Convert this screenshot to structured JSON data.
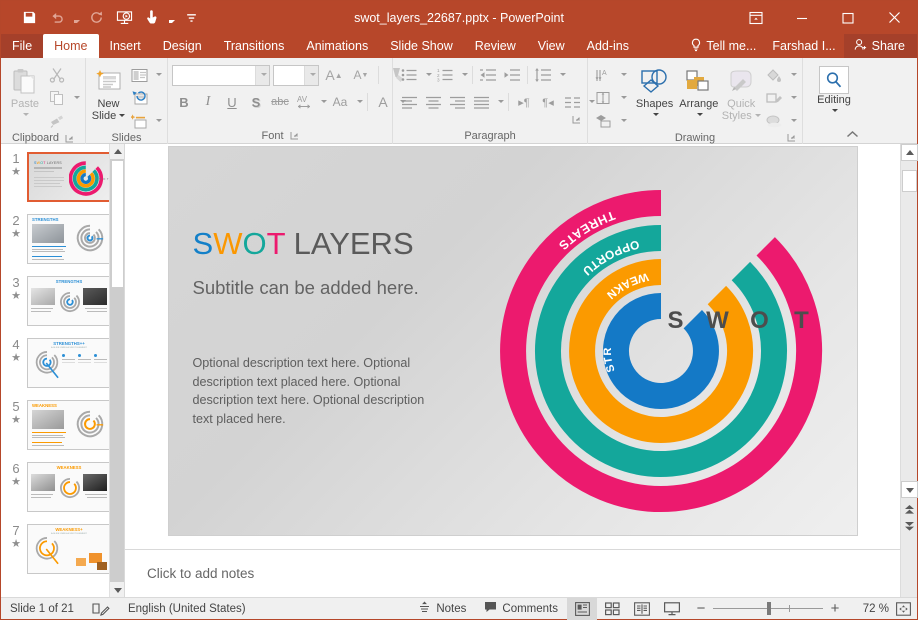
{
  "titlebar": {
    "document_title": "swot_layers_22687.pptx - PowerPoint",
    "quick_access": [
      {
        "name": "save-icon",
        "label": "Save"
      },
      {
        "name": "undo-icon",
        "label": "Undo"
      },
      {
        "name": "redo-icon",
        "label": "Redo"
      },
      {
        "name": "start-presentation-icon",
        "label": "Start From Beginning"
      },
      {
        "name": "touch-mode-icon",
        "label": "Touch/Mouse Mode"
      },
      {
        "name": "customize-qat-icon",
        "label": "Customize Quick Access Toolbar"
      }
    ],
    "window_controls": [
      {
        "name": "ribbon-display-options-icon",
        "label": "Ribbon Display Options"
      },
      {
        "name": "minimize-icon",
        "label": "Minimize"
      },
      {
        "name": "maximize-icon",
        "label": "Restore Down"
      },
      {
        "name": "close-icon",
        "label": "Close"
      }
    ]
  },
  "tabs": [
    {
      "label": "File",
      "active": false,
      "file": true
    },
    {
      "label": "Home",
      "active": true
    },
    {
      "label": "Insert",
      "active": false
    },
    {
      "label": "Design",
      "active": false
    },
    {
      "label": "Transitions",
      "active": false
    },
    {
      "label": "Animations",
      "active": false
    },
    {
      "label": "Slide Show",
      "active": false
    },
    {
      "label": "Review",
      "active": false
    },
    {
      "label": "View",
      "active": false
    },
    {
      "label": "Add-ins",
      "active": false
    }
  ],
  "tabstrip_right": {
    "tell_me": "Tell me...",
    "account": "Farshad I...",
    "share": "Share"
  },
  "ribbon": {
    "groups": [
      {
        "label": "Clipboard",
        "has_launcher": true
      },
      {
        "label": "Slides",
        "has_launcher": false
      },
      {
        "label": "Font",
        "has_launcher": true
      },
      {
        "label": "Paragraph",
        "has_launcher": true
      },
      {
        "label": "Drawing",
        "has_launcher": true
      },
      {
        "label": "",
        "has_launcher": false
      }
    ],
    "clipboard": {
      "paste_label": "Paste",
      "cut_label": "Cut",
      "copy_label": "Copy",
      "format_painter_label": "Format Painter"
    },
    "slides": {
      "new_slide_line1": "New",
      "new_slide_line2": "Slide",
      "layout_label": "Layout",
      "reset_label": "Reset",
      "section_label": "Section"
    },
    "font": {
      "font_name_value": "",
      "font_size_value": "",
      "buttons": [
        "Grow Font",
        "Shrink Font",
        "Clear Formatting",
        "Bold",
        "Italic",
        "Underline",
        "Text Shadow",
        "Strikethrough",
        "Character Spacing",
        "Change Case",
        "Font Color"
      ]
    },
    "paragraph": {
      "buttons": [
        "Bullets",
        "Numbering",
        "Decrease Indent",
        "Increase Indent",
        "Line Spacing",
        "Align Left",
        "Center",
        "Align Right",
        "Justify",
        "Text Direction",
        "Align Text",
        "Convert to SmartArt",
        "Columns"
      ]
    },
    "drawing": {
      "shapes_label": "Shapes",
      "arrange_label": "Arrange",
      "quick_styles_line1": "Quick",
      "quick_styles_line2": "Styles",
      "shape_fill_label": "Shape Fill",
      "shape_outline_label": "Shape Outline",
      "shape_effects_label": "Shape Effects"
    },
    "editing": {
      "label": "Editing"
    },
    "collapse_label": "Collapse the Ribbon"
  },
  "thumbnails": {
    "slides": [
      {
        "number": "1",
        "selected": true
      },
      {
        "number": "2",
        "selected": false
      },
      {
        "number": "3",
        "selected": false
      },
      {
        "number": "4",
        "selected": false
      },
      {
        "number": "5",
        "selected": false
      },
      {
        "number": "6",
        "selected": false
      },
      {
        "number": "7",
        "selected": false
      }
    ],
    "star_glyph": "★"
  },
  "slide": {
    "title_colored": "SWOT",
    "title_rest": " LAYERS",
    "title_letter_colors": [
      "#1480c8",
      "#fb9700",
      "#14a79b",
      "#ec1a6e"
    ],
    "subtitle": "Subtitle can be added here.",
    "description": "Optional description text here. Optional description text placed here. Optional description text here. Optional description text placed here.",
    "swot_letters": [
      "S",
      "W",
      "O",
      "T"
    ],
    "arcs": [
      {
        "label": "STRENGTHS",
        "color": "#1479c6",
        "index": 0
      },
      {
        "label": "WEAKNESSES",
        "color": "#fb9a00",
        "index": 1
      },
      {
        "label": "OPPORTUNITIES",
        "color": "#14a79b",
        "index": 2
      },
      {
        "label": "THREATS",
        "color": "#ec1a6e",
        "index": 3
      }
    ]
  },
  "notes": {
    "placeholder": "Click to add notes"
  },
  "status": {
    "slide_count": "Slide 1 of 21",
    "language": "English (United States)",
    "notes_label": "Notes",
    "comments_label": "Comments",
    "zoom_percent": "72 %",
    "views": [
      {
        "name": "normal-view-button",
        "label": "Normal",
        "active": true
      },
      {
        "name": "slide-sorter-view-button",
        "label": "Slide Sorter",
        "active": false
      },
      {
        "name": "reading-view-button",
        "label": "Reading View",
        "active": false
      },
      {
        "name": "slide-show-button",
        "label": "Slide Show",
        "active": false
      }
    ],
    "zoom_out_label": "−",
    "zoom_in_label": "+",
    "fit_label": "Fit slide to current window"
  }
}
